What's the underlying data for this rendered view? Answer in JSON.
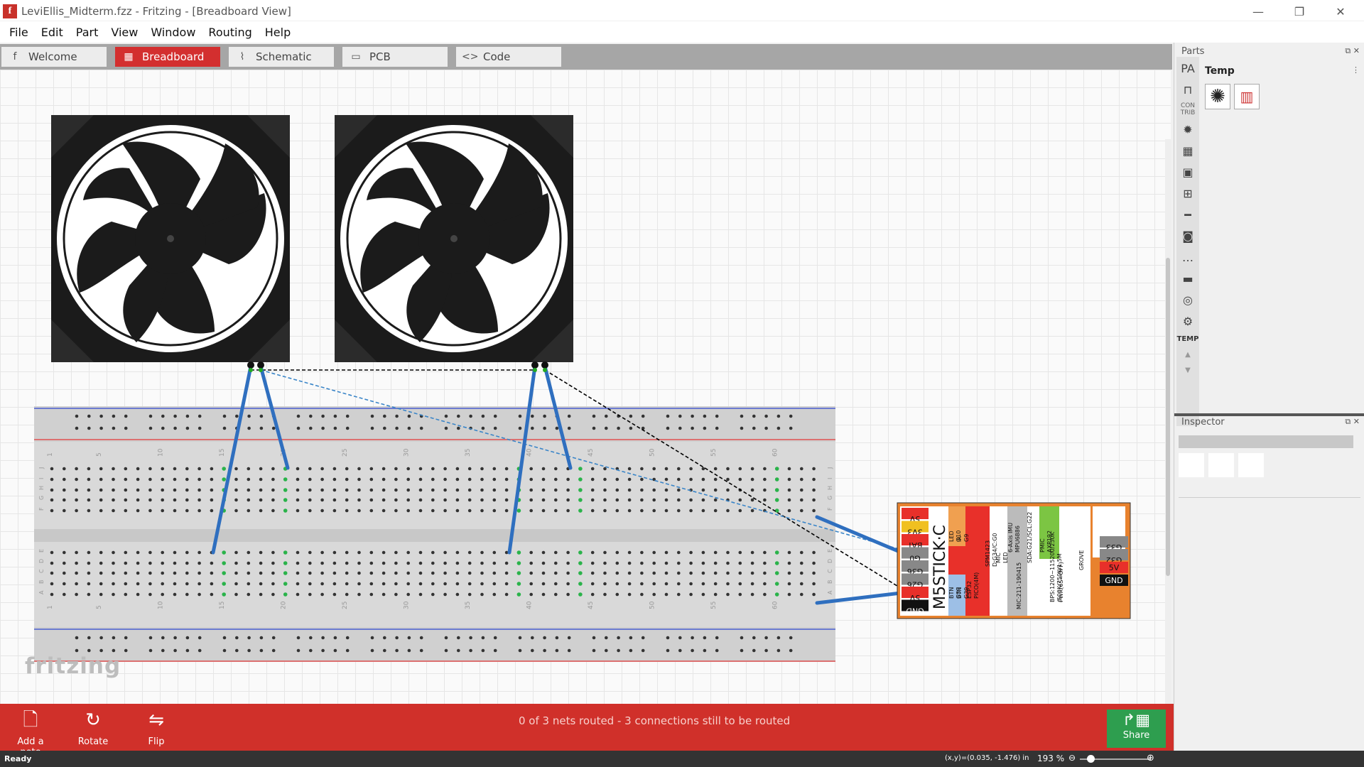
{
  "titlebar": {
    "app_icon": "f",
    "title": "LeviEllis_Midterm.fzz - Fritzing - [Breadboard View]",
    "minimize_icon": "minimize-icon",
    "restore_icon": "restore-icon",
    "close_icon": "close-icon"
  },
  "menubar": {
    "items": [
      "File",
      "Edit",
      "Part",
      "View",
      "Window",
      "Routing",
      "Help"
    ]
  },
  "tabs": [
    {
      "label": "Welcome",
      "icon": "f",
      "active": false
    },
    {
      "label": "Breadboard",
      "icon": "▦",
      "active": true
    },
    {
      "label": "Schematic",
      "icon": "⌇",
      "active": false
    },
    {
      "label": "PCB",
      "icon": "▭",
      "active": false
    },
    {
      "label": "Code",
      "icon": "<>",
      "active": false
    }
  ],
  "canvas": {
    "watermark": "fritzing",
    "breadboard": {
      "column_labels": [
        "1",
        "5",
        "10",
        "15",
        "20",
        "25",
        "30",
        "35",
        "40",
        "45",
        "50",
        "55",
        "60"
      ],
      "rows_top": [
        "J",
        "I",
        "H",
        "G",
        "F"
      ],
      "rows_bottom": [
        "E",
        "D",
        "C",
        "B",
        "A"
      ]
    },
    "m5stick": {
      "brand": "M5STICK·C",
      "left_pins": [
        "5V",
        "3V3",
        "BAT",
        "G0",
        "G36",
        "G26",
        "5V",
        "GND"
      ],
      "right_pins": [
        "G33",
        "G32",
        "5V",
        "GND"
      ],
      "columns": [
        [
          "LED",
          "G10"
        ],
        [
          "IR",
          "G9"
        ],
        [
          "BTN",
          "G37"
        ],
        [
          "BTN",
          "G39"
        ],
        [
          "ESP32",
          "PICO(4M)"
        ],
        [
          "SPM1423",
          "D:G34/C:G0"
        ],
        [
          "MIC",
          "LED"
        ],
        [
          "6-Axis IMU",
          "MPU6886"
        ],
        [
          "SDA:G21/SCL:G22"
        ],
        [
          "PMIC",
          "AXP192"
        ],
        [
          "BPS:1200~115200/250K",
          "/500K/750K/1.5M"
        ],
        [
          "PWR(6S=OFF)"
        ],
        [
          "MIC:211-190415"
        ],
        [
          "GROVE"
        ]
      ]
    }
  },
  "bottombar": {
    "add_note_label": "Add a note",
    "rotate_label": "Rotate",
    "flip_label": "Flip",
    "routing_status": "0 of 3 nets routed - 3 connections still to be routed",
    "share_label": "Share"
  },
  "statusbar": {
    "status": "Ready",
    "coords": "(x,y)=(0.035, -1.476) in",
    "zoom": "193 %"
  },
  "parts_panel": {
    "title": "Parts",
    "bin_title": "Temp",
    "contrib_label": "CON TRIB",
    "temp_label": "TEMP"
  },
  "inspector": {
    "title": "Inspector"
  },
  "colors": {
    "accent_red": "#d32f2f",
    "share_green": "#2e9e4f",
    "wire_blue": "#2f6fbf",
    "ratsnest_blue": "#3a85c8",
    "ratsnest_black": "#000000",
    "m5_orange": "#e8822e"
  }
}
